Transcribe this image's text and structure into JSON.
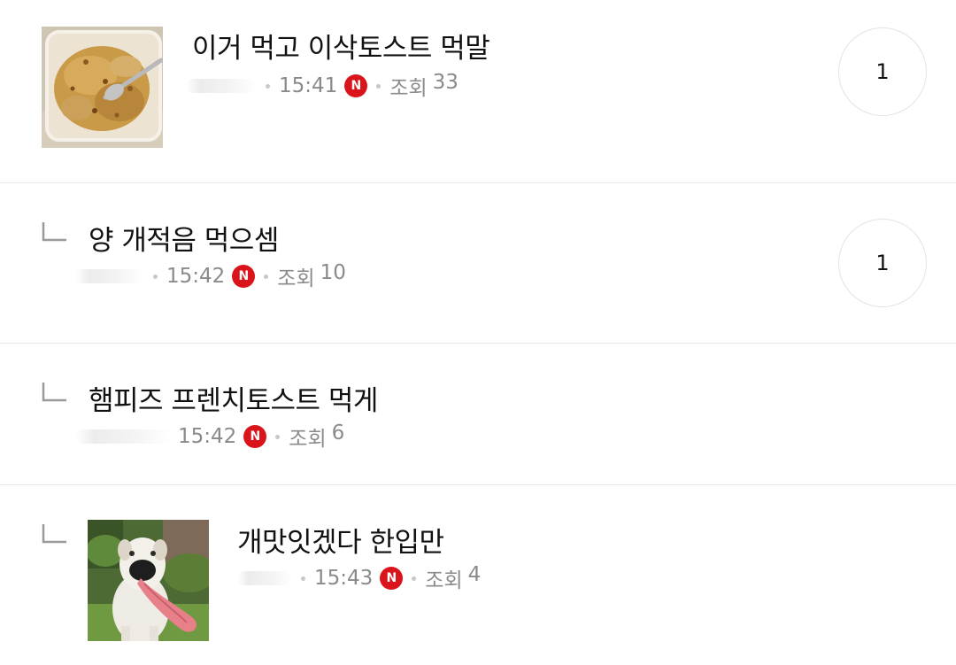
{
  "posts": [
    {
      "title": "이거 먹고 이삭토스트 먹말",
      "time": "15:41",
      "badge": "N",
      "views_label": "조회",
      "views": "33",
      "comments": "1",
      "thumbnail": "rice-in-container-photo",
      "is_reply": false
    },
    {
      "title": "양 개적음 먹으셈",
      "time": "15:42",
      "badge": "N",
      "views_label": "조회",
      "views": "10",
      "comments": "1",
      "is_reply": true
    },
    {
      "title": "햄피즈 프렌치토스트 먹게",
      "time": "15:42",
      "badge": "N",
      "views_label": "조회",
      "views": "6",
      "is_reply": true
    },
    {
      "title": "개맛잇겠다 한입만",
      "time": "15:43",
      "badge": "N",
      "views_label": "조회",
      "views": "4",
      "thumbnail": "dog-tongue-photo",
      "is_reply": true
    }
  ],
  "colors": {
    "new_badge": "#d9151b",
    "meta_text": "#8a8a8a",
    "divider": "#e9e9e9"
  }
}
